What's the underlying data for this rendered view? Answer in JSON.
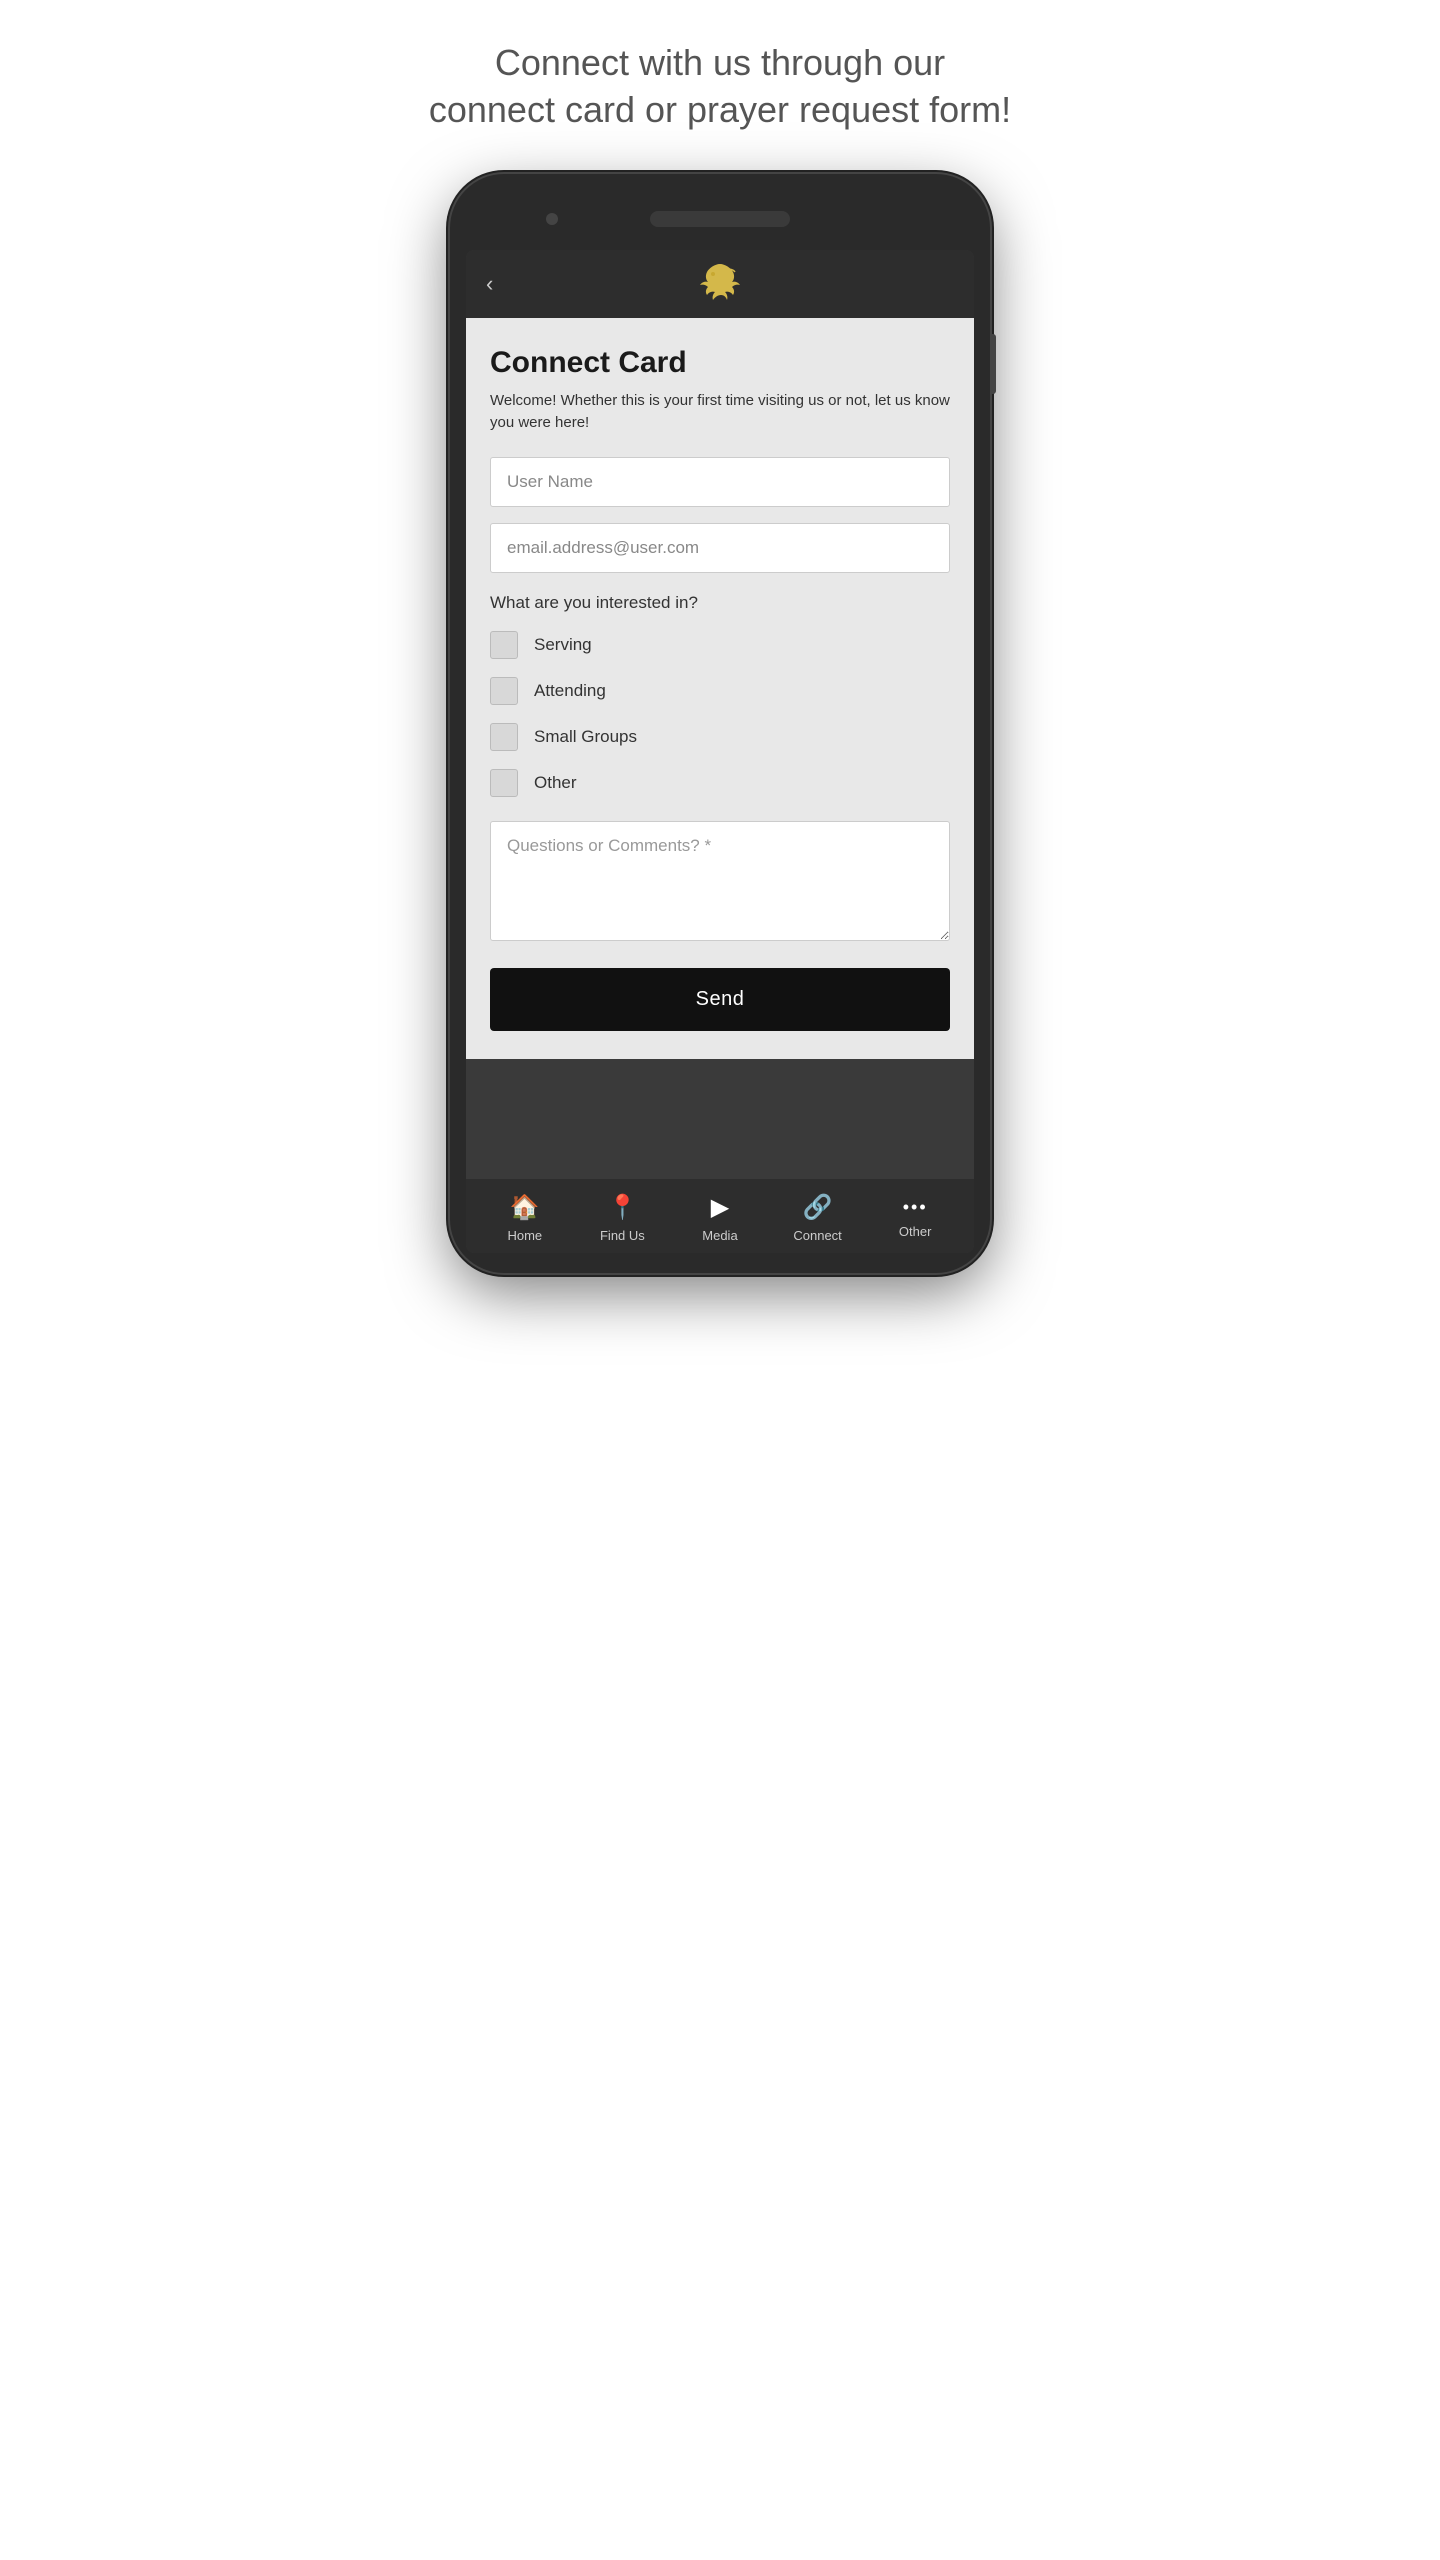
{
  "page": {
    "title_line1": "Connect with us through our",
    "title_line2": "connect card or prayer request form!"
  },
  "header": {
    "back_icon": "‹",
    "logo_alt": "dove"
  },
  "form": {
    "title": "Connect Card",
    "subtitle": "Welcome! Whether this is your first time visiting us or not, let us know you were here!",
    "username_placeholder": "User Name",
    "email_placeholder": "email.address@user.com",
    "interest_label": "What are you interested in?",
    "checkboxes": [
      {
        "id": "serving",
        "label": "Serving"
      },
      {
        "id": "attending",
        "label": "Attending"
      },
      {
        "id": "smallgroups",
        "label": "Small Groups"
      },
      {
        "id": "other",
        "label": "Other"
      }
    ],
    "comments_placeholder": "Questions or Comments? *",
    "send_label": "Send"
  },
  "bottom_nav": {
    "items": [
      {
        "id": "home",
        "icon": "⌂",
        "label": "Home"
      },
      {
        "id": "findus",
        "icon": "◎",
        "label": "Find Us"
      },
      {
        "id": "media",
        "icon": "▶",
        "label": "Media"
      },
      {
        "id": "connect",
        "icon": "⛓",
        "label": "Connect"
      },
      {
        "id": "other",
        "icon": "···",
        "label": "Other"
      }
    ]
  }
}
